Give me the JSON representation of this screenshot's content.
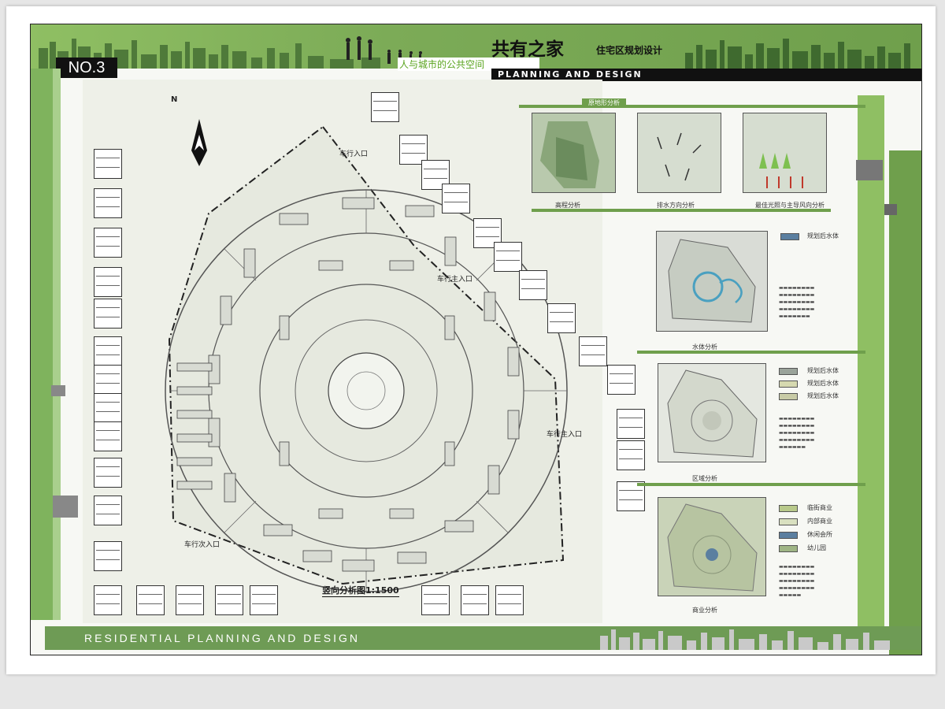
{
  "header": {
    "number": "NO.3",
    "title": "共有之家",
    "subtitle": "住宅区规划设计",
    "tagline": "人与城市的公共空间",
    "planning_label": "PLANNING AND DESIGN"
  },
  "footer": {
    "label": "RESIDENTIAL PLANNING AND DESIGN"
  },
  "plan": {
    "north": "N",
    "caption": "竖向分析图1:1500",
    "entrances": [
      "车行入口",
      "车行主入口",
      "车行主入口",
      "车行次入口"
    ]
  },
  "terrain": {
    "heading": "原地形分析",
    "items": [
      {
        "caption": "高程分析"
      },
      {
        "caption": "排水方向分析"
      },
      {
        "caption": "最佳光照与主导风向分析"
      }
    ]
  },
  "water": {
    "caption": "水体分析",
    "legend": [
      "规划后水体"
    ]
  },
  "zone": {
    "caption": "区域分析",
    "legend": [
      "规划后水体",
      "规划后水体",
      "规划后水体"
    ]
  },
  "commerce": {
    "caption": "商业分析",
    "legend": [
      "临街商业",
      "内部商业",
      "休闲会所",
      "幼儿园"
    ]
  },
  "colors": {
    "band_green": "#7cab57",
    "dark_green": "#6e9b55",
    "legend_blue": "#5b7fa0"
  }
}
